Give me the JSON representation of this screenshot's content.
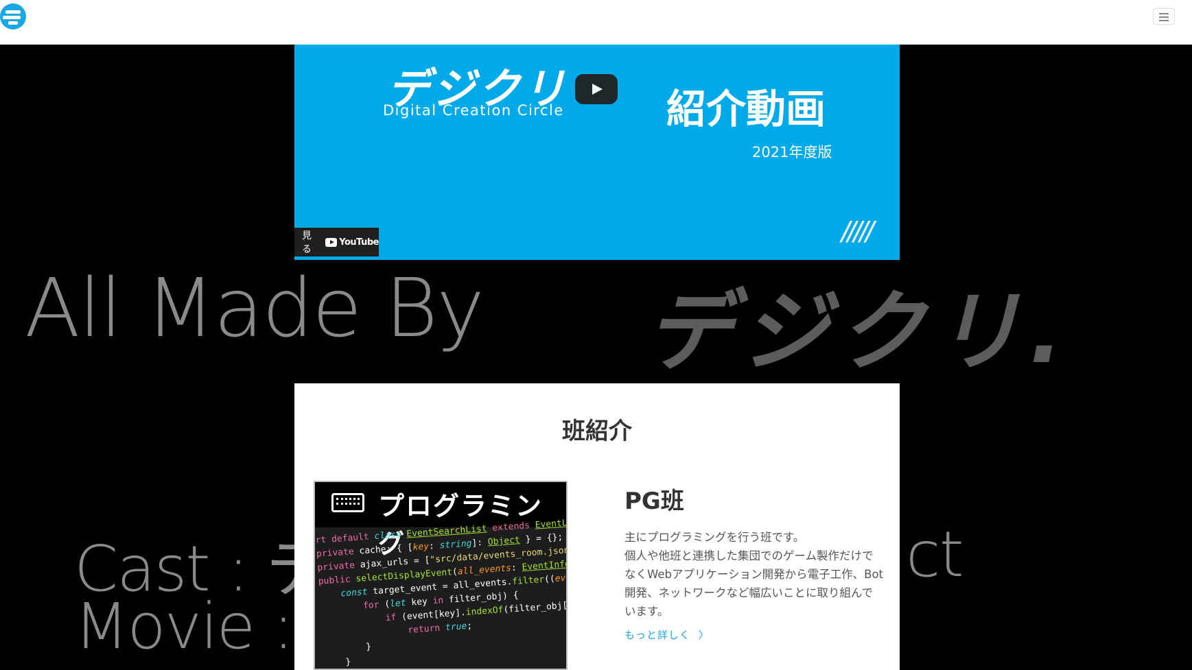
{
  "navbar": {
    "logo_icon": "deji-kuri-logo",
    "menu_icon": "hamburger-icon"
  },
  "background": {
    "line1_left": "All Made By",
    "line1_right": "デジクリ.",
    "line2": "Cast : デ",
    "line2_tail": "ct",
    "line3": "Movie :"
  },
  "video": {
    "brand_jp": "デジクリ",
    "brand_en": "Digital Creation Circle",
    "title": "紹介動画",
    "year": "2021年度版",
    "watch_label": "見る",
    "youtube_label": "YouTube",
    "slashes": "/////",
    "color": "#00a9e8"
  },
  "section": {
    "title": "班紹介",
    "card": {
      "image_label": "プログラミング",
      "title": "PG班",
      "description_line1": "主にプログラミングを行う班です。",
      "description_rest": "個人や他班と連携した集団でのゲーム製作だけでなくWebアプリケーション開発から電子工作、Bot開発、ネットワークなど幅広いことに取り組んでいます。",
      "more_link": "もっと詳しく",
      "more_icon": "chevron-right-icon"
    }
  }
}
